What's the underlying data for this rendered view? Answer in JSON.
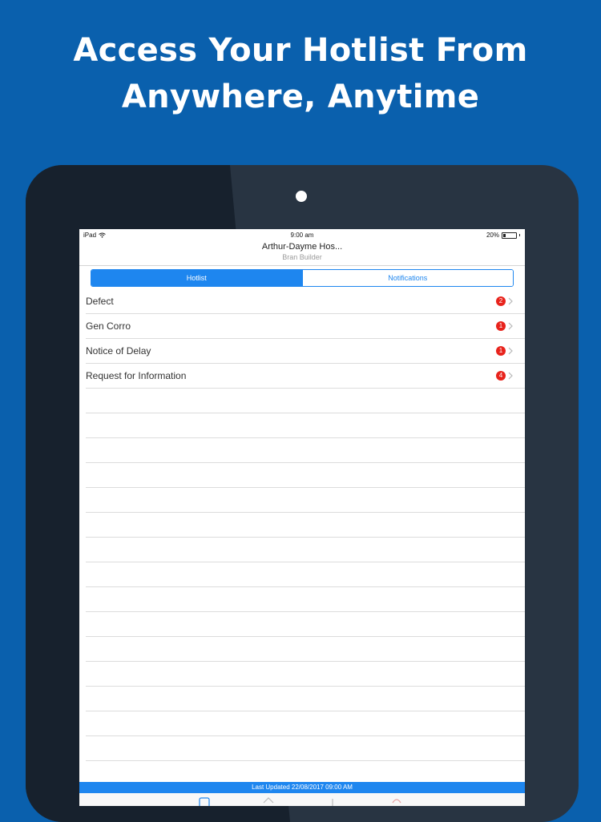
{
  "headline": {
    "line1": "Access Your Hotlist From",
    "line2": "Anywhere, Anytime"
  },
  "status_bar": {
    "device": "iPad",
    "time": "9:00 am",
    "battery": "20%",
    "battery_level": 0.2
  },
  "nav": {
    "title": "Arthur-Dayme Hos...",
    "subtitle": "Bran Builder"
  },
  "segments": [
    {
      "label": "Hotlist",
      "active": true
    },
    {
      "label": "Notifications",
      "active": false
    }
  ],
  "hotlist": [
    {
      "label": "Defect",
      "count": "2"
    },
    {
      "label": "Gen Corro",
      "count": "1"
    },
    {
      "label": "Notice of Delay",
      "count": "1"
    },
    {
      "label": "Request for Information",
      "count": "4"
    }
  ],
  "footer": {
    "last_updated": "Last Updated 22/08/2017 09:00 AM"
  },
  "colors": {
    "background": "#0a60ad",
    "accent": "#1e86ef",
    "badge": "#e8231c"
  }
}
